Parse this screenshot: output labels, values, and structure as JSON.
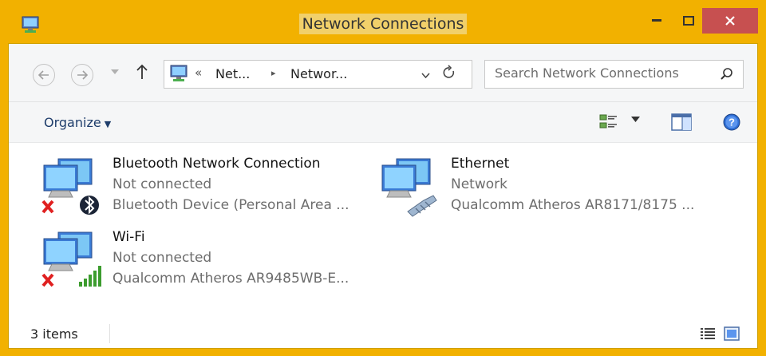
{
  "window": {
    "title": "Network Connections",
    "title_highlight": "#f1d06a",
    "frame_color": "#f2b100",
    "close_color": "#c75050"
  },
  "nav": {
    "back_icon": "back-arrow-icon",
    "forward_icon": "forward-arrow-icon",
    "up_icon": "up-arrow-icon",
    "address": {
      "overflow": "«",
      "crumbs": [
        "Net...",
        "Networ..."
      ],
      "separator": "▸"
    },
    "search": {
      "placeholder": "Search Network Connections"
    }
  },
  "command_bar": {
    "organize_label": "Organize",
    "view_icon": "change-view-icon",
    "preview_pane_icon": "preview-pane-icon",
    "help_icon": "help-icon"
  },
  "connections": [
    {
      "name": "Bluetooth Network Connection",
      "status": "Not connected",
      "device": "Bluetooth Device (Personal Area ...",
      "overlay_icon": "bluetooth-icon",
      "disconnected": true
    },
    {
      "name": "Ethernet",
      "status": "Network",
      "device": "Qualcomm Atheros AR8171/8175 ...",
      "overlay_icon": "ethernet-cable-icon",
      "disconnected": false
    },
    {
      "name": "Wi-Fi",
      "status": "Not connected",
      "device": "Qualcomm Atheros AR9485WB-E...",
      "overlay_icon": "wifi-signal-icon",
      "disconnected": true
    }
  ],
  "status_bar": {
    "item_count": "3 items"
  }
}
